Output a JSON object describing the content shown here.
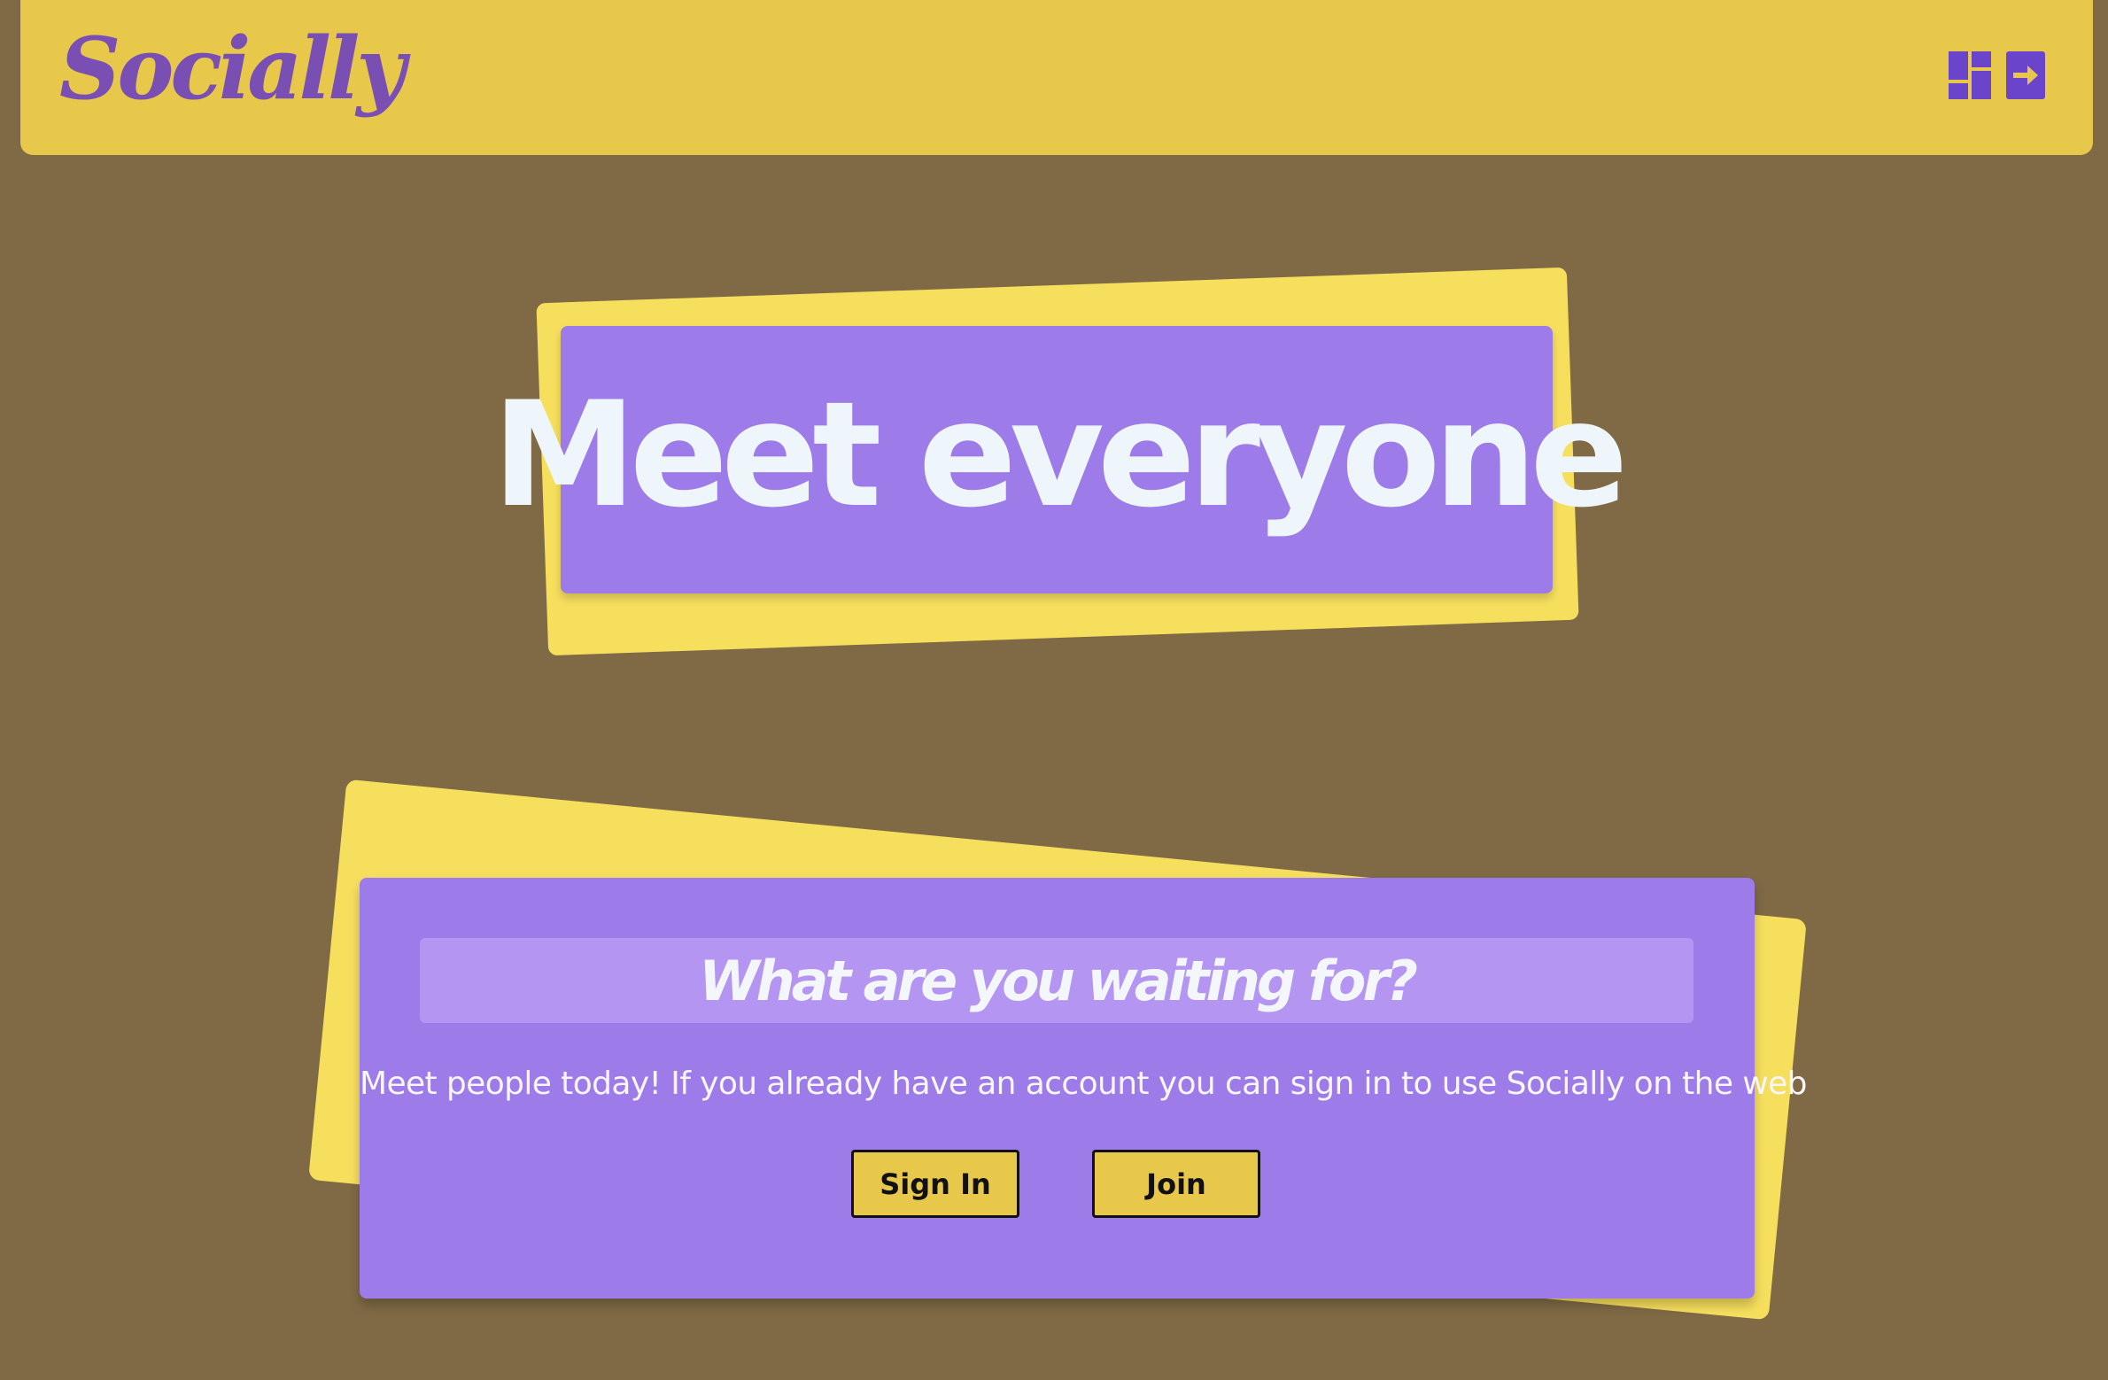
{
  "header": {
    "logo_text": "Socially",
    "icons": [
      "dashboard-icon",
      "sign-in-icon"
    ]
  },
  "hero": {
    "title": "Meet everyone"
  },
  "card": {
    "heading": "What are you waiting for?",
    "description": "Meet people today! If you already have an account you can sign in to use Socially on the web",
    "sign_in_label": "Sign In",
    "join_label": "Join"
  },
  "colors": {
    "background": "#7f6a45",
    "header": "#e8c84a",
    "accent_yellow": "#f7df5e",
    "accent_purple": "#9d7be8",
    "logo_purple": "#7a4fb4",
    "icon_purple": "#6a45cc"
  }
}
